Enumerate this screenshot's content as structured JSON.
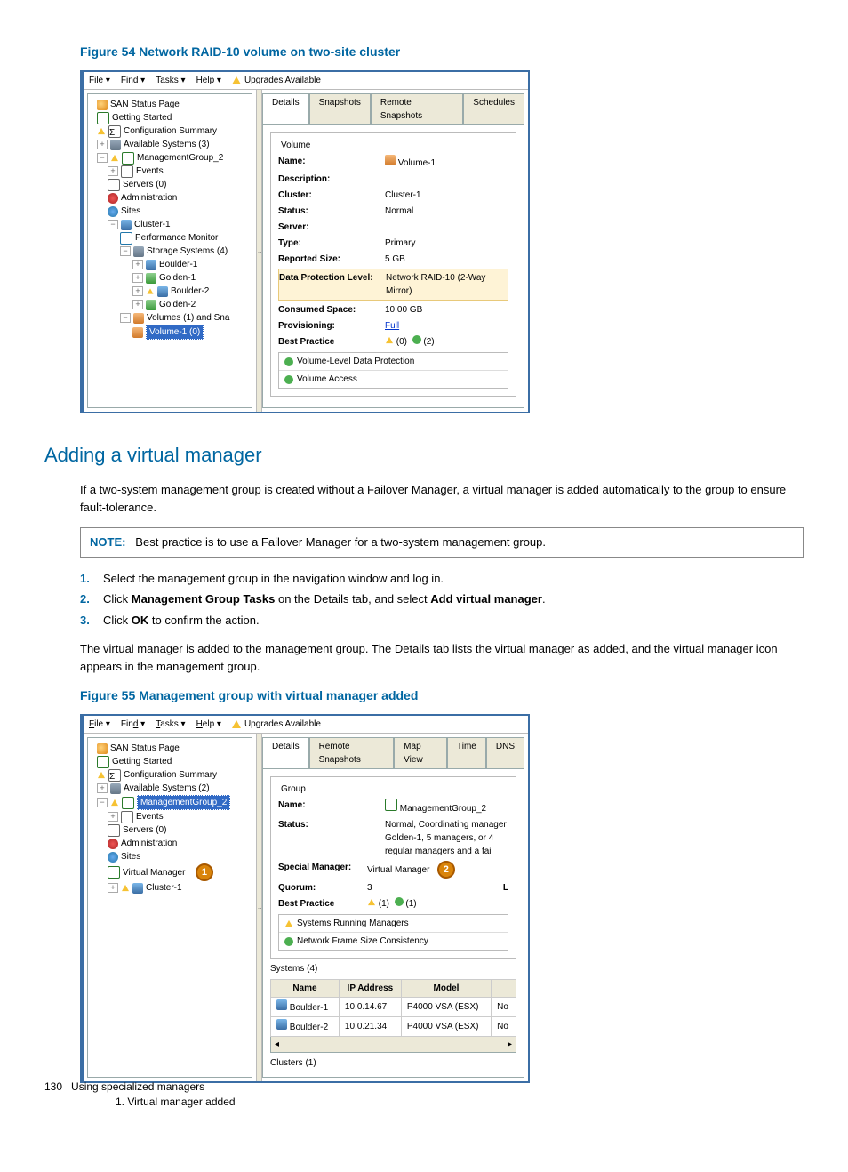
{
  "figure54": {
    "caption": "Figure 54 Network RAID-10 volume on two-site cluster",
    "menu": {
      "file": "File",
      "find": "Find",
      "tasks": "Tasks",
      "help": "Help",
      "upgrades": "Upgrades Available"
    },
    "tree": {
      "san": "SAN Status Page",
      "getting": "Getting Started",
      "config": "Configuration Summary",
      "avail": "Available Systems (3)",
      "mg": "ManagementGroup_2",
      "events": "Events",
      "servers": "Servers (0)",
      "admin": "Administration",
      "sites": "Sites",
      "cluster": "Cluster-1",
      "perf": "Performance Monitor",
      "storage": "Storage Systems (4)",
      "b1": "Boulder-1",
      "g1": "Golden-1",
      "b2": "Boulder-2",
      "g2": "Golden-2",
      "vols": "Volumes (1) and Sna",
      "vol1": "Volume-1 (0)"
    },
    "tabs": {
      "details": "Details",
      "snapshots": "Snapshots",
      "remote": "Remote Snapshots",
      "schedules": "Schedules"
    },
    "volume": {
      "legend": "Volume",
      "name_k": "Name:",
      "name_v": "Volume-1",
      "desc_k": "Description:",
      "cluster_k": "Cluster:",
      "cluster_v": "Cluster-1",
      "status_k": "Status:",
      "status_v": "Normal",
      "server_k": "Server:",
      "type_k": "Type:",
      "type_v": "Primary",
      "size_k": "Reported Size:",
      "size_v": "5 GB",
      "dpl_k": "Data Protection Level:",
      "dpl_v": "Network RAID-10 (2-Way Mirror)",
      "cons_k": "Consumed Space:",
      "cons_v": "10.00 GB",
      "prov_k": "Provisioning:",
      "prov_v": "Full",
      "bp_k": "Best Practice",
      "bp_warn": "(0)",
      "bp_ok": "(2)",
      "bp1": "Volume-Level Data Protection",
      "bp2": "Volume Access"
    }
  },
  "section": {
    "title": "Adding a virtual manager",
    "p1": "If a two-system management group is created without a Failover Manager, a virtual manager is added automatically to the group to ensure fault-tolerance.",
    "note_label": "NOTE:",
    "note_body": "Best practice is to use a Failover Manager for a two-system management group.",
    "s1_num": "1.",
    "s1": "Select the management group in the navigation window and log in.",
    "s2_num": "2.",
    "s2a": "Click ",
    "s2b": "Management Group Tasks",
    "s2c": " on the Details tab, and select ",
    "s2d": "Add virtual manager",
    "s2e": ".",
    "s3_num": "3.",
    "s3a": "Click ",
    "s3b": "OK",
    "s3c": " to confirm the action.",
    "p2": "The virtual manager is added to the management group. The Details tab lists the virtual manager as added, and the virtual manager icon appears in the management group."
  },
  "figure55": {
    "caption": "Figure 55 Management group with virtual manager added",
    "tree": {
      "san": "SAN Status Page",
      "getting": "Getting Started",
      "config": "Configuration Summary",
      "avail": "Available Systems (2)",
      "mg": "ManagementGroup_2",
      "events": "Events",
      "servers": "Servers (0)",
      "admin": "Administration",
      "sites": "Sites",
      "vmgr": "Virtual Manager",
      "cluster": "Cluster-1"
    },
    "tabs": {
      "details": "Details",
      "remote": "Remote Snapshots",
      "map": "Map View",
      "time": "Time",
      "dns": "DNS"
    },
    "group": {
      "legend": "Group",
      "name_k": "Name:",
      "name_v": "ManagementGroup_2",
      "status_k": "Status:",
      "status_v": "Normal, Coordinating manager Golden-1, 5 managers, or 4 regular managers and a fai",
      "special_k": "Special Manager:",
      "special_v": "Virtual Manager",
      "quorum_k": "Quorum:",
      "quorum_v": "3",
      "bp_k": "Best Practice",
      "bp_warn": "(1)",
      "bp_ok": "(1)",
      "bp1": "Systems Running Managers",
      "bp2": "Network Frame Size Consistency"
    },
    "systems": {
      "title": "Systems (4)",
      "h_name": "Name",
      "h_ip": "IP Address",
      "h_model": "Model",
      "r1_name": "Boulder-1",
      "r1_ip": "10.0.14.67",
      "r1_model": "P4000 VSA (ESX)",
      "r1_e": "No",
      "r2_name": "Boulder-2",
      "r2_ip": "10.0.21.34",
      "r2_model": "P4000 VSA (ESX)",
      "r2_e": "No"
    },
    "clusters": "Clusters (1)",
    "legend_text": "1. Virtual manager added"
  },
  "footer": {
    "page": "130",
    "title": "Using specialized managers"
  }
}
